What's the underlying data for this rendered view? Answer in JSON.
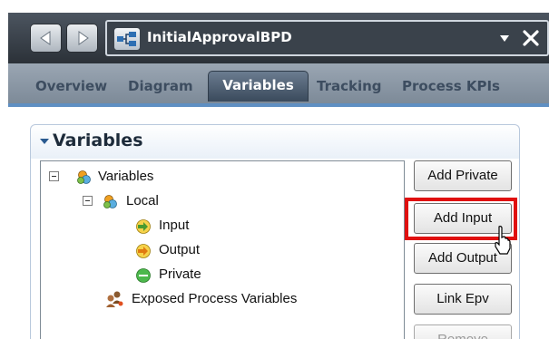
{
  "title_bar": {
    "document_title": "InitialApprovalBPD",
    "back_icon": "left-arrow-icon",
    "forward_icon": "right-arrow-icon",
    "document_icon": "process-diagram-icon",
    "dropdown_icon": "dropdown-triangle-icon",
    "close_icon": "close-x-icon"
  },
  "tabs": [
    {
      "label": "Overview",
      "active": false
    },
    {
      "label": "Diagram",
      "active": false
    },
    {
      "label": "Variables",
      "active": true
    },
    {
      "label": "Tracking",
      "active": false
    },
    {
      "label": "Process KPIs",
      "active": false
    }
  ],
  "section": {
    "title": "Variables",
    "collapse_icon": "expanded-triangle-icon"
  },
  "tree": [
    {
      "label": "Variables",
      "icon": "variables-folder-icon",
      "expander": "minus"
    },
    {
      "label": "Local",
      "icon": "variables-folder-icon",
      "expander": "minus"
    },
    {
      "label": "Input",
      "icon": "input-arrow-icon"
    },
    {
      "label": "Output",
      "icon": "output-arrow-icon"
    },
    {
      "label": "Private",
      "icon": "private-circle-icon"
    },
    {
      "label": "Exposed Process Variables",
      "icon": "exposed-variables-icon"
    }
  ],
  "buttons": {
    "add_private": "Add Private",
    "add_input": "Add Input",
    "add_output": "Add Output",
    "link_epv": "Link Epv",
    "remove": "Remove"
  },
  "colors": {
    "highlight": "#e01010",
    "titlebar": "#343b44",
    "active_tab": "#3a4a5c"
  }
}
